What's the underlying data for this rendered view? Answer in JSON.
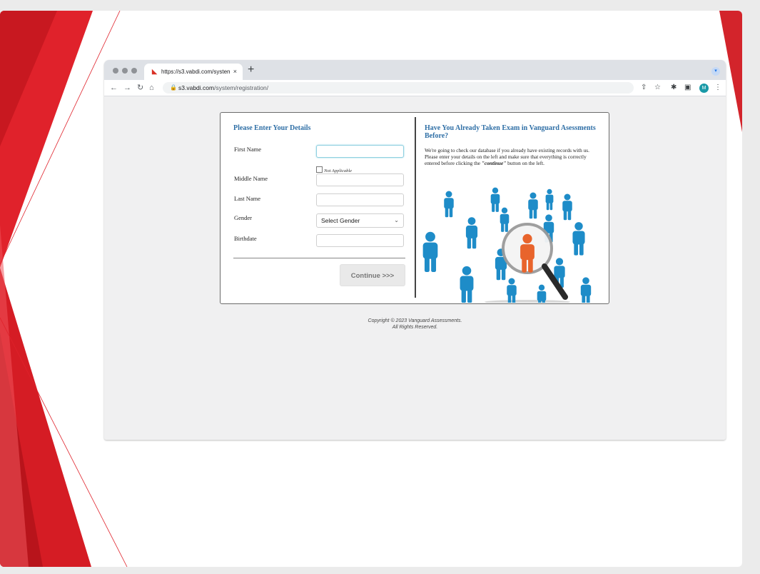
{
  "browser": {
    "tab_title": "https://s3.vabdi.com/system/re",
    "tab_close": "×",
    "new_tab": "+",
    "url_host": "s3.vabdi.com",
    "url_path": "/system/registration/",
    "avatar_letter": "M",
    "icons": [
      "back-icon",
      "forward-icon",
      "reload-icon",
      "home-icon",
      "lock-icon",
      "share-icon",
      "star-icon",
      "extensions-icon",
      "sidepanel-icon",
      "menu-icon"
    ]
  },
  "form": {
    "heading": "Please Enter Your Details",
    "first_name_label": "First Name",
    "not_applicable_label": "Not Applicable",
    "middle_name_label": "Middle Name",
    "last_name_label": "Last Name",
    "gender_label": "Gender",
    "gender_selected": "Select Gender",
    "birthdate_label": "Birthdate",
    "continue_label": "Continue >>>"
  },
  "info": {
    "heading": "Have You Already Taken Exam in Vanguard Asessments Before?",
    "body_before": "We're going to check our database if you already have existing records with us. Please enter your details on the left and make sure that everything is correctly entered before clicking the ",
    "body_emphasis": "\"continue\"",
    "body_after": " button on the left."
  },
  "footer": {
    "line1": "Copyright © 2023 Vanguard Assessments.",
    "line2": "All Rights Reserved."
  },
  "colors": {
    "heading_blue": "#2f6fa6",
    "brand_red": "#e0222b",
    "person_blue": "#1e8cc8",
    "person_orange": "#e8642c"
  }
}
